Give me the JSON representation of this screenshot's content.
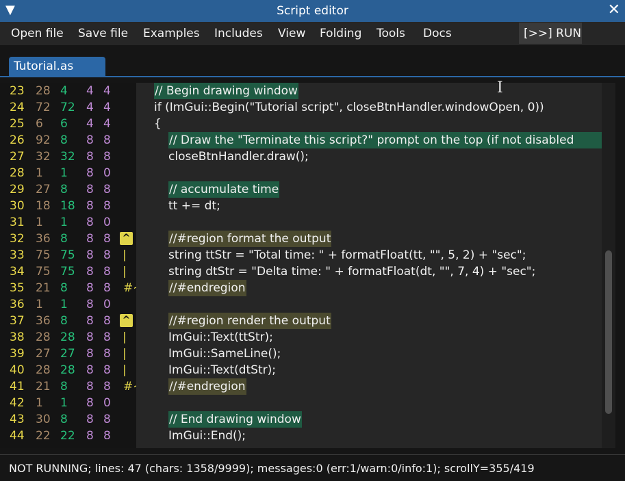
{
  "window": {
    "title": "Script editor",
    "collapse_icon": "▼",
    "close_icon": "✕"
  },
  "menu": {
    "items": [
      "Open file",
      "Save file",
      "Examples",
      "Includes",
      "View",
      "Folding",
      "Tools",
      "Docs"
    ],
    "run_label": "[>>] RUN"
  },
  "tab": {
    "label": "Tutorial.as"
  },
  "colors": {
    "accent": "#2b67a6",
    "line_number": "#e8d84a",
    "comment_highlight": "#1f5b43",
    "region_highlight": "#4b4a2f"
  },
  "gutter": [
    {
      "ln": "23",
      "c1": "28",
      "c2": "4",
      "c3": "4",
      "c4": "4",
      "fold": ""
    },
    {
      "ln": "24",
      "c1": "72",
      "c2": "72",
      "c3": "4",
      "c4": "4",
      "fold": ""
    },
    {
      "ln": "25",
      "c1": "6",
      "c2": "6",
      "c3": "4",
      "c4": "4",
      "fold": ""
    },
    {
      "ln": "26",
      "c1": "92",
      "c2": "8",
      "c3": "8",
      "c4": "8",
      "fold": ""
    },
    {
      "ln": "27",
      "c1": "32",
      "c2": "32",
      "c3": "8",
      "c4": "8",
      "fold": ""
    },
    {
      "ln": "28",
      "c1": "1",
      "c2": "1",
      "c3": "8",
      "c4": "0",
      "fold": ""
    },
    {
      "ln": "29",
      "c1": "27",
      "c2": "8",
      "c3": "8",
      "c4": "8",
      "fold": ""
    },
    {
      "ln": "30",
      "c1": "18",
      "c2": "18",
      "c3": "8",
      "c4": "8",
      "fold": ""
    },
    {
      "ln": "31",
      "c1": "1",
      "c2": "1",
      "c3": "8",
      "c4": "0",
      "fold": ""
    },
    {
      "ln": "32",
      "c1": "36",
      "c2": "8",
      "c3": "8",
      "c4": "8",
      "fold": "^"
    },
    {
      "ln": "33",
      "c1": "75",
      "c2": "75",
      "c3": "8",
      "c4": "8",
      "fold": "|"
    },
    {
      "ln": "34",
      "c1": "75",
      "c2": "75",
      "c3": "8",
      "c4": "8",
      "fold": "|"
    },
    {
      "ln": "35",
      "c1": "21",
      "c2": "8",
      "c3": "8",
      "c4": "8",
      "fold": "#~"
    },
    {
      "ln": "36",
      "c1": "1",
      "c2": "1",
      "c3": "8",
      "c4": "0",
      "fold": ""
    },
    {
      "ln": "37",
      "c1": "36",
      "c2": "8",
      "c3": "8",
      "c4": "8",
      "fold": "^"
    },
    {
      "ln": "38",
      "c1": "28",
      "c2": "28",
      "c3": "8",
      "c4": "8",
      "fold": "|"
    },
    {
      "ln": "39",
      "c1": "27",
      "c2": "27",
      "c3": "8",
      "c4": "8",
      "fold": "|"
    },
    {
      "ln": "40",
      "c1": "28",
      "c2": "28",
      "c3": "8",
      "c4": "8",
      "fold": "|"
    },
    {
      "ln": "41",
      "c1": "21",
      "c2": "8",
      "c3": "8",
      "c4": "8",
      "fold": "#~"
    },
    {
      "ln": "42",
      "c1": "1",
      "c2": "1",
      "c3": "8",
      "c4": "0",
      "fold": ""
    },
    {
      "ln": "43",
      "c1": "30",
      "c2": "8",
      "c3": "8",
      "c4": "8",
      "fold": ""
    },
    {
      "ln": "44",
      "c1": "22",
      "c2": "22",
      "c3": "8",
      "c4": "8",
      "fold": ""
    }
  ],
  "code": [
    {
      "indent": 0,
      "text": "// Begin drawing window",
      "hl": "comment"
    },
    {
      "indent": 0,
      "text": "if (ImGui::Begin(\"Tutorial script\", closeBtnHandler.windowOpen, 0))",
      "hl": ""
    },
    {
      "indent": 0,
      "text": "{",
      "hl": ""
    },
    {
      "indent": 1,
      "text": "// Draw the \"Terminate this script?\" prompt on the top (if not disabled",
      "hl": "comment"
    },
    {
      "indent": 1,
      "text": "closeBtnHandler.draw();",
      "hl": ""
    },
    {
      "indent": 1,
      "text": "",
      "hl": ""
    },
    {
      "indent": 1,
      "text": "// accumulate time",
      "hl": "comment"
    },
    {
      "indent": 1,
      "text": "tt += dt;",
      "hl": ""
    },
    {
      "indent": 1,
      "text": "",
      "hl": ""
    },
    {
      "indent": 1,
      "text": "//#region format the output",
      "hl": "region"
    },
    {
      "indent": 1,
      "text": "string ttStr = \"Total time: \" + formatFloat(tt, \"\", 5, 2) + \"sec\";",
      "hl": ""
    },
    {
      "indent": 1,
      "text": "string dtStr = \"Delta time: \" + formatFloat(dt, \"\", 7, 4) + \"sec\";",
      "hl": ""
    },
    {
      "indent": 1,
      "text": "//#endregion",
      "hl": "region"
    },
    {
      "indent": 1,
      "text": "",
      "hl": ""
    },
    {
      "indent": 1,
      "text": "//#region render the output",
      "hl": "region"
    },
    {
      "indent": 1,
      "text": "ImGui::Text(ttStr);",
      "hl": ""
    },
    {
      "indent": 1,
      "text": "ImGui::SameLine();",
      "hl": ""
    },
    {
      "indent": 1,
      "text": "ImGui::Text(dtStr);",
      "hl": ""
    },
    {
      "indent": 1,
      "text": "//#endregion",
      "hl": "region"
    },
    {
      "indent": 1,
      "text": "",
      "hl": ""
    },
    {
      "indent": 1,
      "text": "// End drawing window",
      "hl": "comment"
    },
    {
      "indent": 1,
      "text": "ImGui::End();",
      "hl": ""
    }
  ],
  "status": {
    "text": "NOT RUNNING; lines: 47 (chars: 1358/9999); messages:0 (err:1/warn:0/info:1); scrollY=355/419"
  }
}
